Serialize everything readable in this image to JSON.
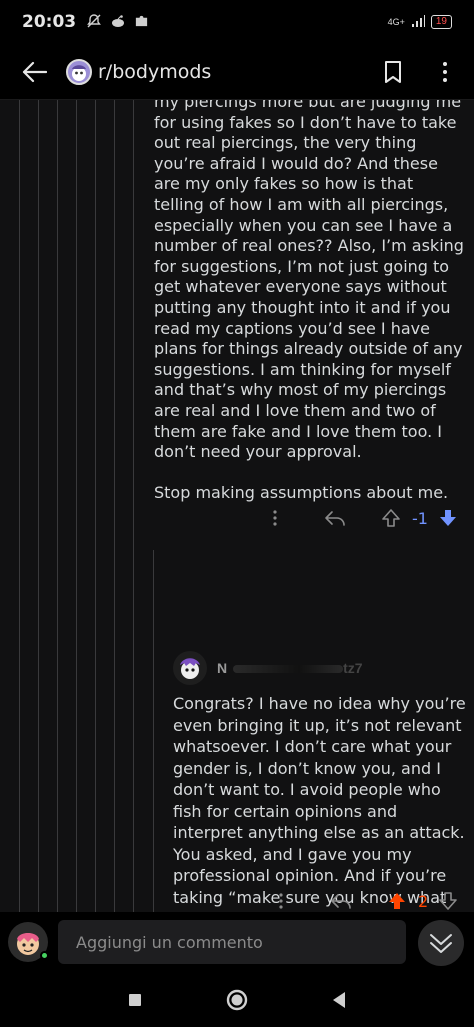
{
  "status_bar": {
    "time": "20:03",
    "network": "4G+",
    "battery": "19"
  },
  "header": {
    "subreddit": "r/bodymods"
  },
  "comment1": {
    "paragraphs": [
      "my piercings more but are judging me for using fakes so I don’t have to take out real piercings, the very thing you’re afraid I would do? And these are my only fakes so how is that telling of how I am with all piercings, especially when you can see I have a number of real ones?? Also, I’m asking for suggestions, I’m not just going to get whatever everyone says without putting any thought into it and if you read my captions you’d see I have plans for things already outside of any suggestions. I am thinking for myself and that’s why most of my piercings are real and I love them and two of them are fake and I love them too. I don’t need your approval.",
      "Stop making assumptions about me."
    ],
    "vote_count": "-1"
  },
  "comment2": {
    "username_visible": "N",
    "username_tail": "tz7",
    "text": "Congrats? I have no idea why you’re even bringing it up, it’s not relevant whatsoever. I don’t care what your gender is, I don’t know you, and I don’t want to. I avoid people who fish for certain opinions and interpret anything else as an attack. You asked, and I gave you my professional opinion. And if you’re taking “make sure you know what you want before you act” as an insult.. well, you have a lot of maturing to do. Also, small advice, don’t preach gender right after misgendering someone, kiddo.",
    "vote_count": "2"
  },
  "compose": {
    "placeholder": "Aggiungi un commento"
  },
  "colors": {
    "downvote": "#7193ff",
    "upvote": "#ff4500",
    "online": "#46d160"
  }
}
